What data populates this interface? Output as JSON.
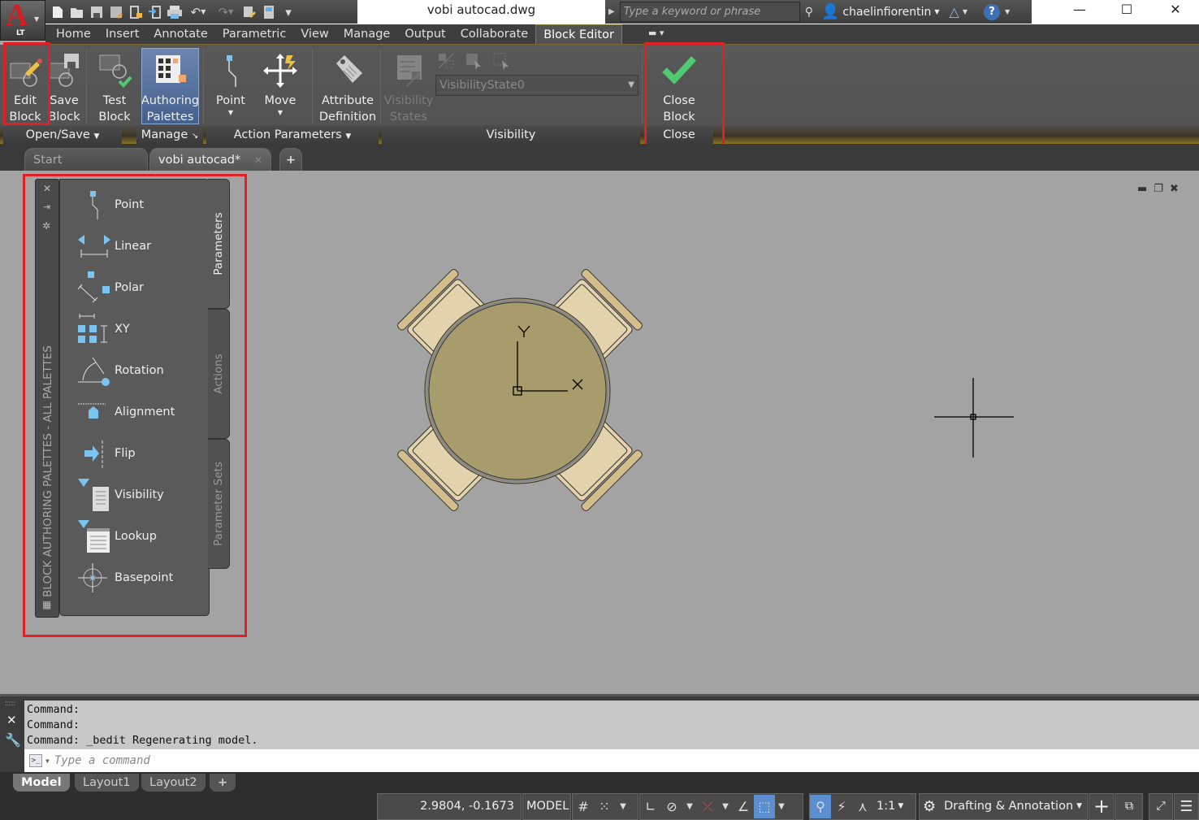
{
  "app": {
    "logo_letter": "A",
    "edition": "LT",
    "document_title": "vobi autocad.dwg",
    "search_placeholder": "Type a keyword or phrase",
    "username": "chaelinfiorentin"
  },
  "window_controls": {
    "minimize": "—",
    "maximize": "☐",
    "close": "✕"
  },
  "quick_access": [
    "new-icon",
    "open-icon",
    "save-icon",
    "save-as-icon",
    "open-from-mobile-icon",
    "share-icon",
    "plot-icon",
    "undo-icon",
    "redo-icon",
    "match-properties-icon",
    "workspace-icon",
    "customize-icon"
  ],
  "menu_tabs": [
    {
      "label": "Home"
    },
    {
      "label": "Insert"
    },
    {
      "label": "Annotate"
    },
    {
      "label": "Parametric"
    },
    {
      "label": "View"
    },
    {
      "label": "Manage"
    },
    {
      "label": "Output"
    },
    {
      "label": "Collaborate"
    },
    {
      "label": "Block Editor",
      "active": true
    }
  ],
  "ribbon": {
    "buttons": {
      "edit_block": "Edit\nBlock",
      "edit_block_1": "Edit",
      "edit_block_2": "Block",
      "save_block_1": "Save",
      "save_block_2": "Block",
      "test_block_1": "Test",
      "test_block_2": "Block",
      "authoring_1": "Authoring",
      "authoring_2": "Palettes",
      "point": "Point",
      "move": "Move",
      "attr_1": "Attribute",
      "attr_2": "Definition",
      "vis_states_1": "Visibility",
      "vis_states_2": "States",
      "close_1": "Close",
      "close_2": "Block Editor"
    },
    "visibility_state": "VisibilityState0",
    "groups": {
      "open_save": "Open/Save",
      "manage": "Manage",
      "action_parameters": "Action Parameters",
      "visibility": "Visibility",
      "close": "Close"
    }
  },
  "doc_tabs": [
    {
      "label": "Start"
    },
    {
      "label": "vobi autocad*",
      "active": true
    }
  ],
  "palette": {
    "title": "BLOCK AUTHORING PALETTES - ALL PALETTES",
    "tabs": [
      "Parameters",
      "Actions",
      "Parameter Sets"
    ],
    "active_tab": "Parameters",
    "items": [
      {
        "label": "Point"
      },
      {
        "label": "Linear"
      },
      {
        "label": "Polar"
      },
      {
        "label": "XY"
      },
      {
        "label": "Rotation"
      },
      {
        "label": "Alignment"
      },
      {
        "label": "Flip"
      },
      {
        "label": "Visibility"
      },
      {
        "label": "Lookup"
      },
      {
        "label": "Basepoint"
      }
    ]
  },
  "drawing": {
    "ucs_x_label": "X",
    "ucs_y_label": "Y",
    "table_color": "#a89c6c",
    "chair_color": "#e3d3ad",
    "chair_back_color": "#d4be8c"
  },
  "command": {
    "history": [
      "Command:",
      "Command:",
      "Command: _bedit Regenerating model."
    ],
    "input_placeholder": "Type a command"
  },
  "layout_tabs": [
    {
      "label": "Model",
      "active": true
    },
    {
      "label": "Layout1"
    },
    {
      "label": "Layout2"
    }
  ],
  "status": {
    "coordinates": "2.9804, -0.1673",
    "space": "MODEL",
    "annotation_scale": "1:1",
    "workspace": "Drafting & Annotation"
  },
  "colors": {
    "accent_highlight": "#e31e24",
    "active_blue": "#5b8fd0",
    "check_green": "#4ecb71"
  }
}
